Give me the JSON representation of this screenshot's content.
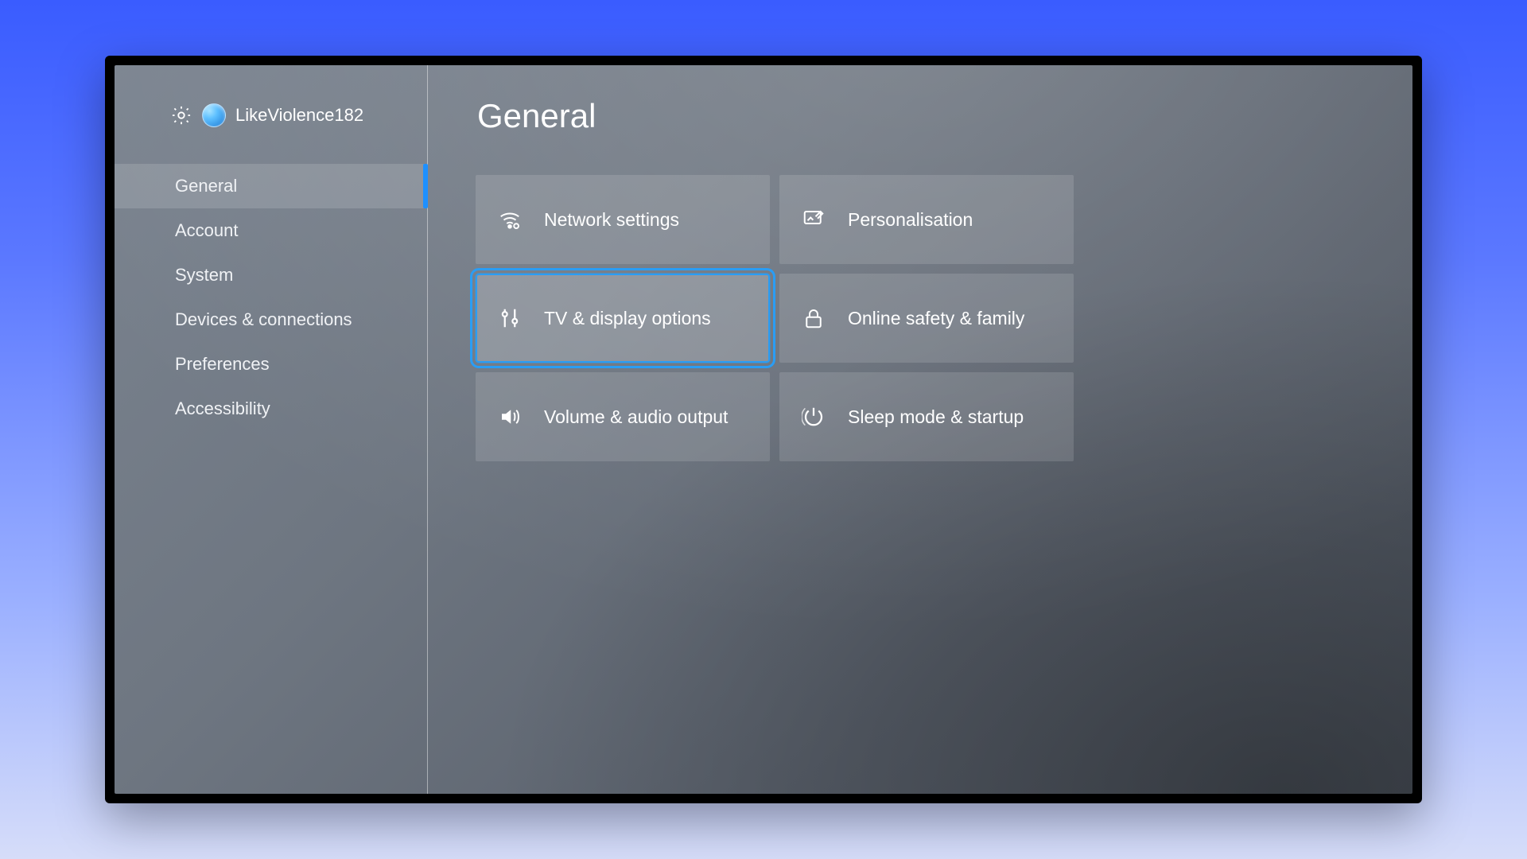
{
  "page_title": "General",
  "profile": {
    "gamertag": "LikeViolence182"
  },
  "sidebar": {
    "items": [
      {
        "label": "General",
        "active": true
      },
      {
        "label": "Account",
        "active": false
      },
      {
        "label": "System",
        "active": false
      },
      {
        "label": "Devices & connections",
        "active": false
      },
      {
        "label": "Preferences",
        "active": false
      },
      {
        "label": "Accessibility",
        "active": false
      }
    ]
  },
  "tiles": [
    {
      "label": "Network settings",
      "icon": "network-icon",
      "focused": false
    },
    {
      "label": "Personalisation",
      "icon": "brush-icon",
      "focused": false
    },
    {
      "label": "TV & display options",
      "icon": "sliders-icon",
      "focused": true
    },
    {
      "label": "Online safety & family",
      "icon": "lock-icon",
      "focused": false
    },
    {
      "label": "Volume & audio output",
      "icon": "volume-icon",
      "focused": false
    },
    {
      "label": "Sleep mode & startup",
      "icon": "power-icon",
      "focused": false
    }
  ],
  "colors": {
    "accent": "#2a9df4"
  }
}
